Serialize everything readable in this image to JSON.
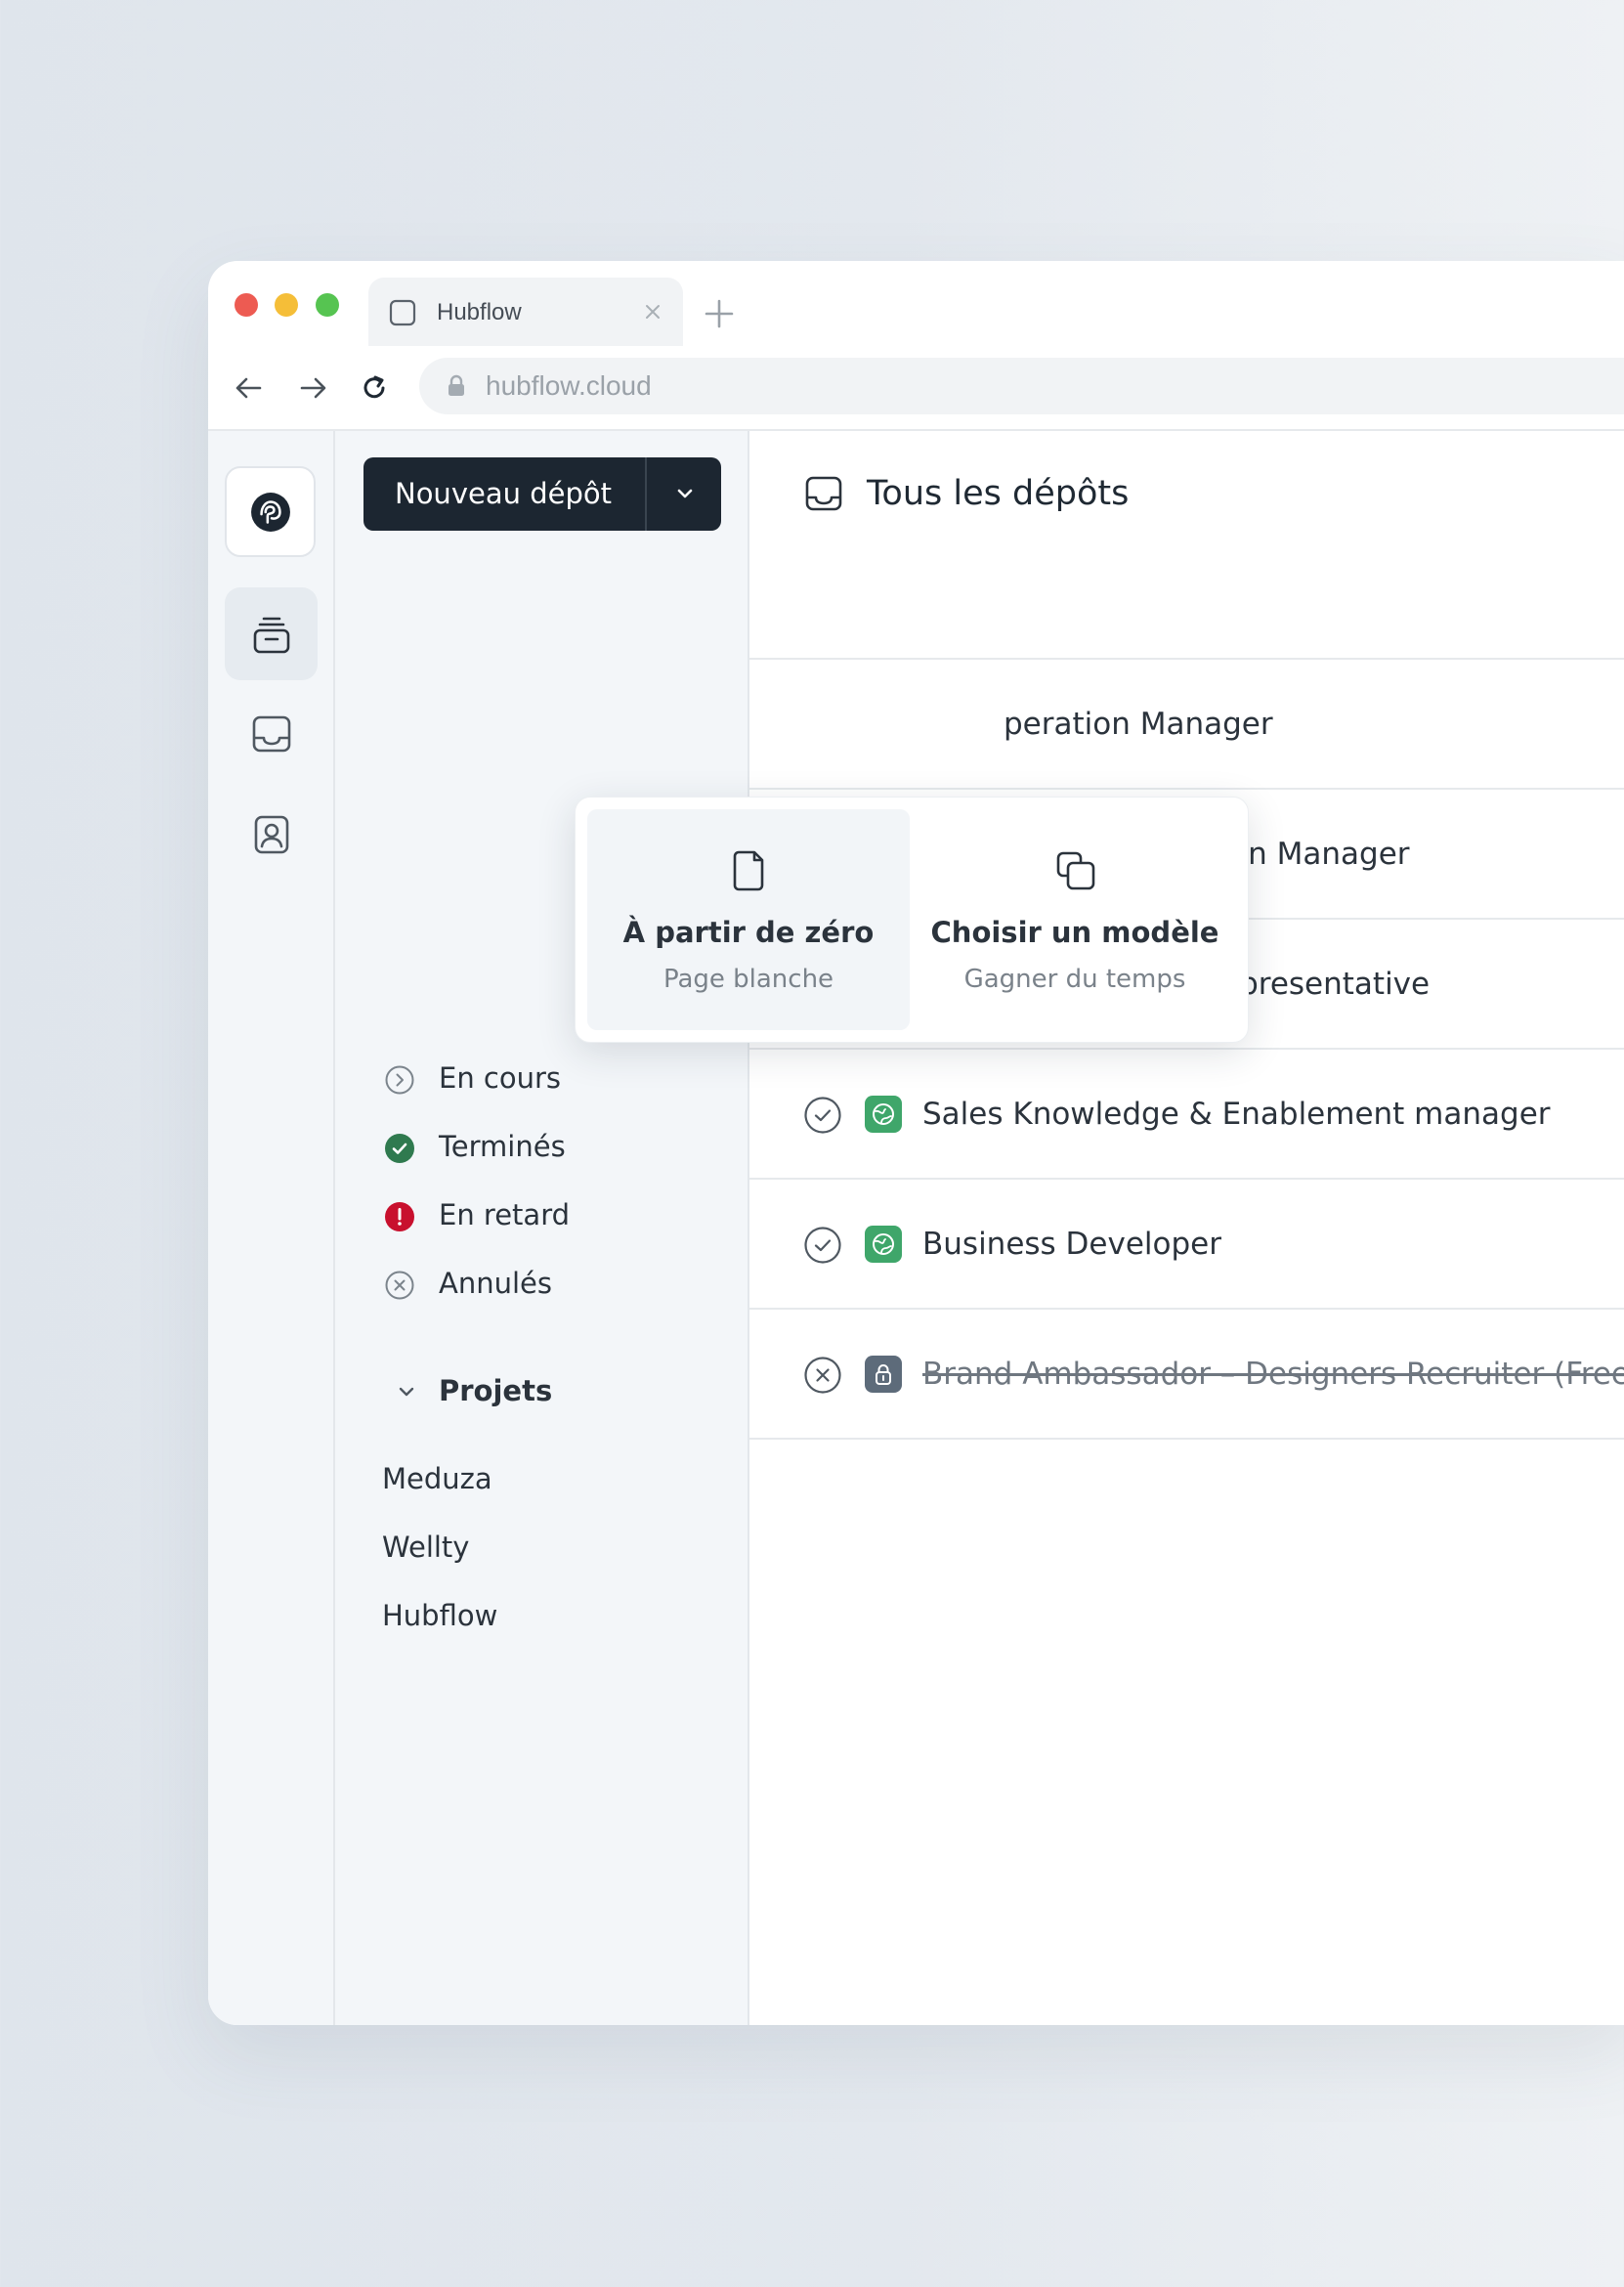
{
  "browser": {
    "tab_title": "Hubflow",
    "url": "hubflow.cloud"
  },
  "icons": {
    "rail": [
      "logo-icon",
      "stack-icon",
      "inbox-icon",
      "contact-icon"
    ],
    "main_title": "inbox-icon"
  },
  "colors": {
    "primary_button": "#1c2631",
    "success": "#2f7a4f",
    "danger": "#c8102e",
    "badge_locked": "#5d6b7a",
    "badge_public": "#3fa66a"
  },
  "sidebar": {
    "new_button_label": "Nouveau dépôt",
    "statuses": [
      {
        "label": "En cours",
        "icon": "chevron-circle-icon"
      },
      {
        "label": "Terminés",
        "icon": "check-circle-filled-icon"
      },
      {
        "label": "En retard",
        "icon": "alert-circle-filled-icon"
      },
      {
        "label": "Annulés",
        "icon": "x-circle-icon"
      }
    ],
    "projects_label": "Projets",
    "projects": [
      "Meduza",
      "Wellty",
      "Hubflow"
    ]
  },
  "dropdown": {
    "options": [
      {
        "title": "À partir de zéro",
        "subtitle": "Page blanche",
        "icon": "blank-page-icon"
      },
      {
        "title": "Choisir un modèle",
        "subtitle": "Gagner du temps",
        "icon": "copy-template-icon"
      }
    ]
  },
  "main": {
    "title": "Tous les dépôts",
    "rows": [
      {
        "title": "perperation Manager",
        "visible_title": "peration Manager",
        "status": "hidden"
      },
      {
        "title": "Senior Paid Acquisition Manager",
        "status": "in-progress",
        "badge": "locked"
      },
      {
        "title": "Customer Service Representative",
        "status": "late",
        "badge": "locked"
      },
      {
        "title": "Sales Knowledge & Enablement manager",
        "status": "done",
        "badge": "public"
      },
      {
        "title": "Business Developer",
        "status": "done",
        "badge": "public"
      },
      {
        "title": "Brand Ambassador – Designers Recruiter (Freel",
        "status": "cancelled",
        "badge": "locked"
      }
    ]
  }
}
